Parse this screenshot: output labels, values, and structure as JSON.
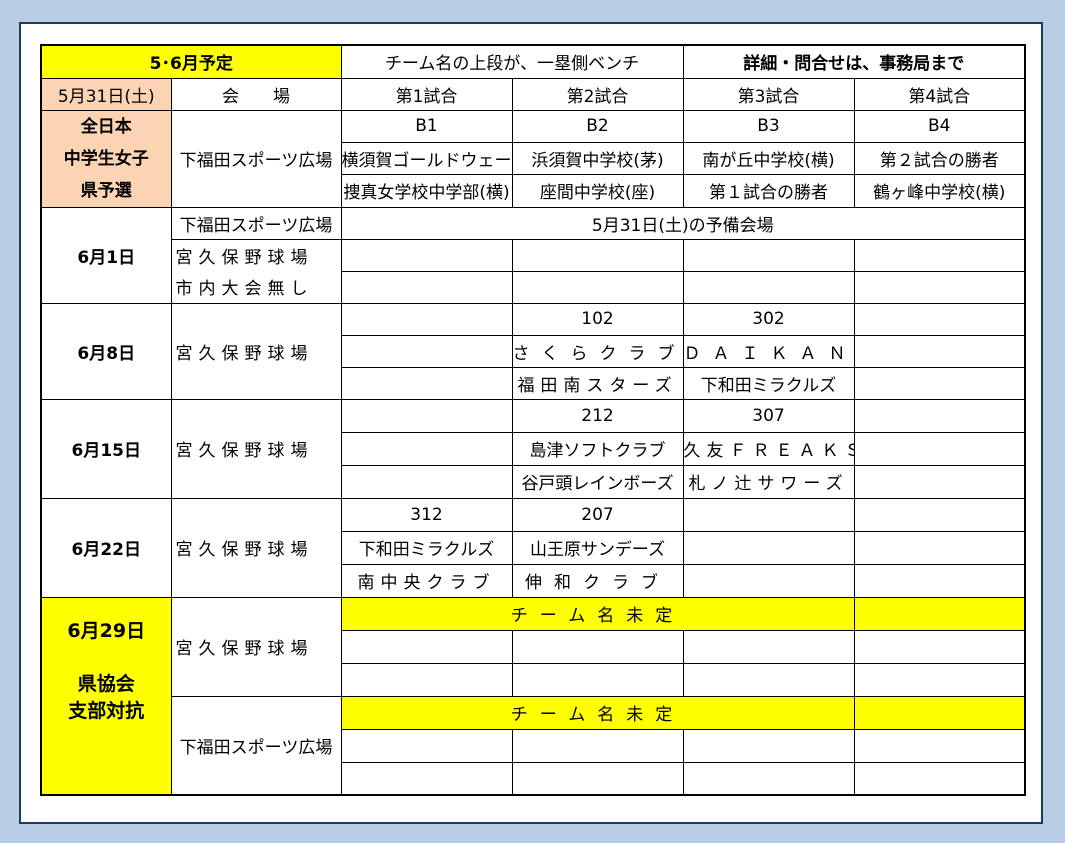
{
  "header": {
    "title": "5･6月予定",
    "bench_note": "チーム名の上段が、一塁側ベンチ",
    "contact": "詳細・問合せは、事務局まで"
  },
  "columns": {
    "date": "5月31日(土)",
    "venue": "会　　場",
    "g1": "第1試合",
    "g2": "第2試合",
    "g3": "第3試合",
    "g4": "第4試合"
  },
  "may31": {
    "category": [
      "全日本",
      "中学生女子",
      "県予選"
    ],
    "venue": "下福田スポーツ広場",
    "codes": [
      "B1",
      "B2",
      "B3",
      "B4"
    ],
    "upper": [
      "横須賀ゴールドウェーブ",
      "浜須賀中学校(茅)",
      "南が丘中学校(横)",
      "第２試合の勝者"
    ],
    "lower": [
      "捜真女学校中学部(横)",
      "座間中学校(座)",
      "第１試合の勝者",
      "鶴ヶ峰中学校(横)"
    ]
  },
  "jun1": {
    "date": "6月1日",
    "venue1": "下福田スポーツ広場",
    "note": "5月31日(土)の予備会場",
    "venue2_line1": "宮久保野球場",
    "venue2_line2": "市内大会無し"
  },
  "jun8": {
    "date": "6月8日",
    "venue": "宮久保野球場",
    "codes": [
      "",
      "102",
      "302",
      ""
    ],
    "upper": [
      "",
      "さくらクラブ",
      "ＤＡＩＫＡＮ",
      ""
    ],
    "lower": [
      "",
      "福田南スターズ",
      "下和田ミラクルズ",
      ""
    ]
  },
  "jun15": {
    "date": "6月15日",
    "venue": "宮久保野球場",
    "codes": [
      "",
      "212",
      "307",
      ""
    ],
    "upper": [
      "",
      "島津ソフトクラブ",
      "久友ＦＲＥＡＫＳ",
      ""
    ],
    "lower": [
      "",
      "谷戸頭レインボーズ",
      "札ノ辻サワーズ",
      ""
    ]
  },
  "jun22": {
    "date": "6月22日",
    "venue": "宮久保野球場",
    "codes": [
      "312",
      "207",
      "",
      ""
    ],
    "upper": [
      "下和田ミラクルズ",
      "山王原サンデーズ",
      "",
      ""
    ],
    "lower": [
      "南中央クラブ",
      "伸和クラブ",
      "",
      ""
    ]
  },
  "jun29": {
    "date": "6月29日",
    "category_line1": "県協会",
    "category_line2": "支部対抗",
    "venue1": "宮久保野球場",
    "venue2": "下福田スポーツ広場",
    "undecided": "チーム名未定"
  },
  "colors": {
    "background": "#b9cde5",
    "highlight": "#ffff00",
    "category_cell": "#fbd4b4",
    "contact_text": "#e00000"
  }
}
